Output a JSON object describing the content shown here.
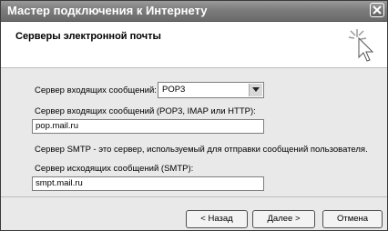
{
  "window": {
    "title": "Мастер подключения к Интернету"
  },
  "header": {
    "title": "Серверы электронной почты",
    "icon": "wizard-cursor-icon"
  },
  "form": {
    "incoming_type_label": "Сервер входящих сообщений:",
    "incoming_type_value": "POP3",
    "incoming_server_label": "Сервер входящих сообщений (POP3, IMAP или HTTP):",
    "incoming_server_value": "pop.mail.ru",
    "smtp_note": "Сервер SMTP - это сервер, используемый для отправки сообщений  пользователя.",
    "outgoing_server_label": "Сервер исходящих сообщений (SMTP):",
    "outgoing_server_value": "smpt.mail.ru"
  },
  "buttons": {
    "back": "< Назад",
    "next": "Далее >",
    "cancel": "Отмена"
  }
}
